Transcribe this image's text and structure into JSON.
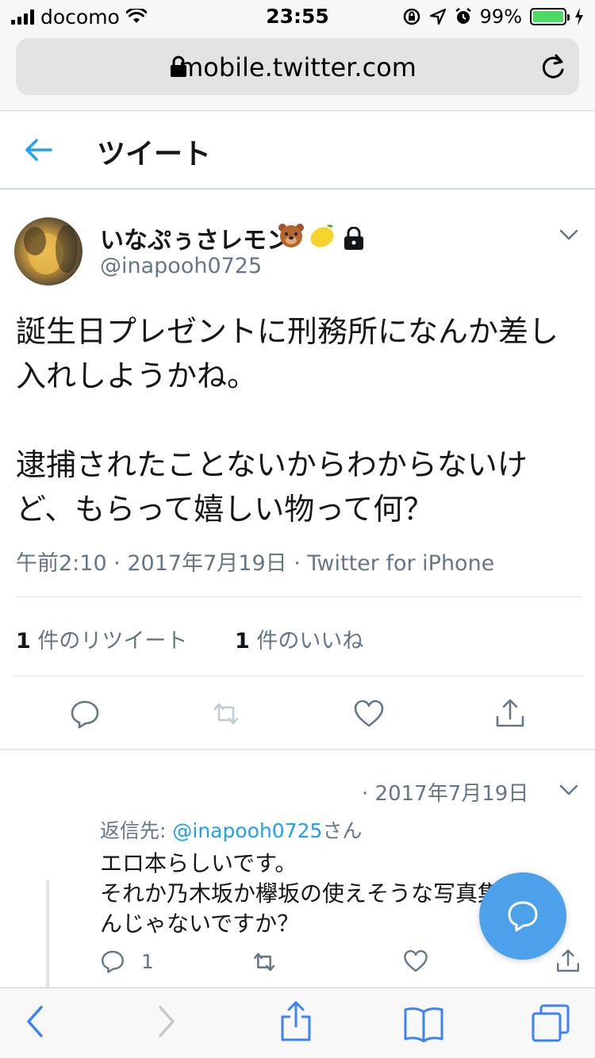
{
  "status_bar": {
    "carrier": "docomo",
    "time": "23:55",
    "battery": "99%",
    "battery_level": 0.99
  },
  "browser": {
    "url": "mobile.twitter.com"
  },
  "header": {
    "title": "ツイート"
  },
  "tweet": {
    "display_name": "いなぷぅさレモン",
    "emojis": [
      "bear-face",
      "lemon",
      "lock"
    ],
    "handle": "@inapooh0725",
    "text": "誕生日プレゼントに刑務所になんか差し入れしようかね。\n\n逮捕されたことないからわからないけど、もらって嬉しい物って何？",
    "meta": "午前2:10 · 2017年7月19日 · Twitter for iPhone",
    "retweets_count": "1",
    "retweets_label": "件のリツイート",
    "likes_count": "1",
    "likes_label": "件のいいね"
  },
  "reply": {
    "date": "· 2017年7月19日",
    "reply_to_prefix": "返信先: ",
    "reply_to_mention": "@inapooh0725",
    "reply_to_suffix": "さん",
    "text": "エロ本らしいです。\nそれか乃木坂か欅坂の使えそうな写真集じゃ\nんじゃないですか？",
    "reply_count": "1"
  },
  "colors": {
    "accent": "#1da1f2",
    "fab": "#4da1ea",
    "muted": "#657786",
    "divider": "#e1e8ed",
    "safari_blue": "#3a82f7"
  }
}
